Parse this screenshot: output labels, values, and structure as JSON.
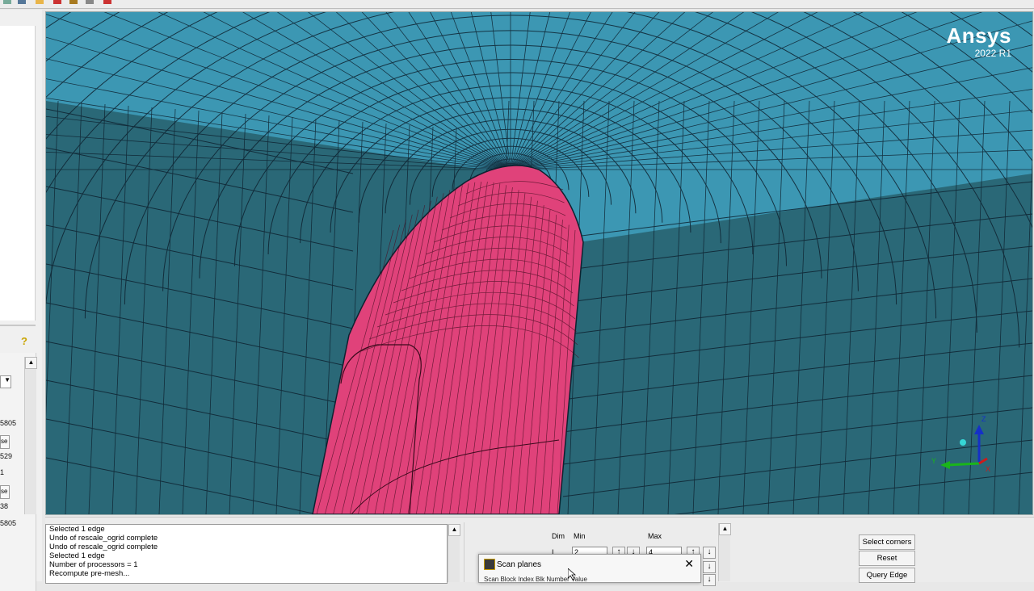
{
  "viewport": {
    "brand_name": "Ansys",
    "brand_version": "2022 R1",
    "colors": {
      "background_mesh": "#2a6877",
      "top_wall": "#3c97b3",
      "body": "#e0427a",
      "mesh_lines": "#0e2230"
    },
    "axes": {
      "z": "Z",
      "y": "Y",
      "x": "X"
    }
  },
  "left_panel": {
    "values": [
      "5805",
      "529",
      "1",
      "38",
      "5805"
    ],
    "buttons": [
      "se",
      "se"
    ],
    "combo_arrow": "▼",
    "scroll_up": "▲",
    "help_icon": "question-bulb-icon"
  },
  "console": {
    "lines": [
      "Selected 1 edge",
      "Undo of rescale_ogrid complete",
      "Undo of rescale_ogrid complete",
      "Selected 1 edge",
      "Number of processors = 1",
      "Recompute pre-mesh..."
    ],
    "scroll_up": "▲"
  },
  "form": {
    "col_dim": "Dim",
    "col_min": "Min",
    "col_max": "Max",
    "dim_value": "I",
    "min_value": "2",
    "max_value": "4",
    "spin_up": "↑",
    "spin_down": "↓"
  },
  "scan_dialog": {
    "title": "Scan planes",
    "close": "✕",
    "row2": "Scan    Block Index   Blk Number   Value"
  },
  "right_buttons": {
    "select_corners": "Select corners",
    "reset": "Reset",
    "query_edge": "Query Edge"
  }
}
